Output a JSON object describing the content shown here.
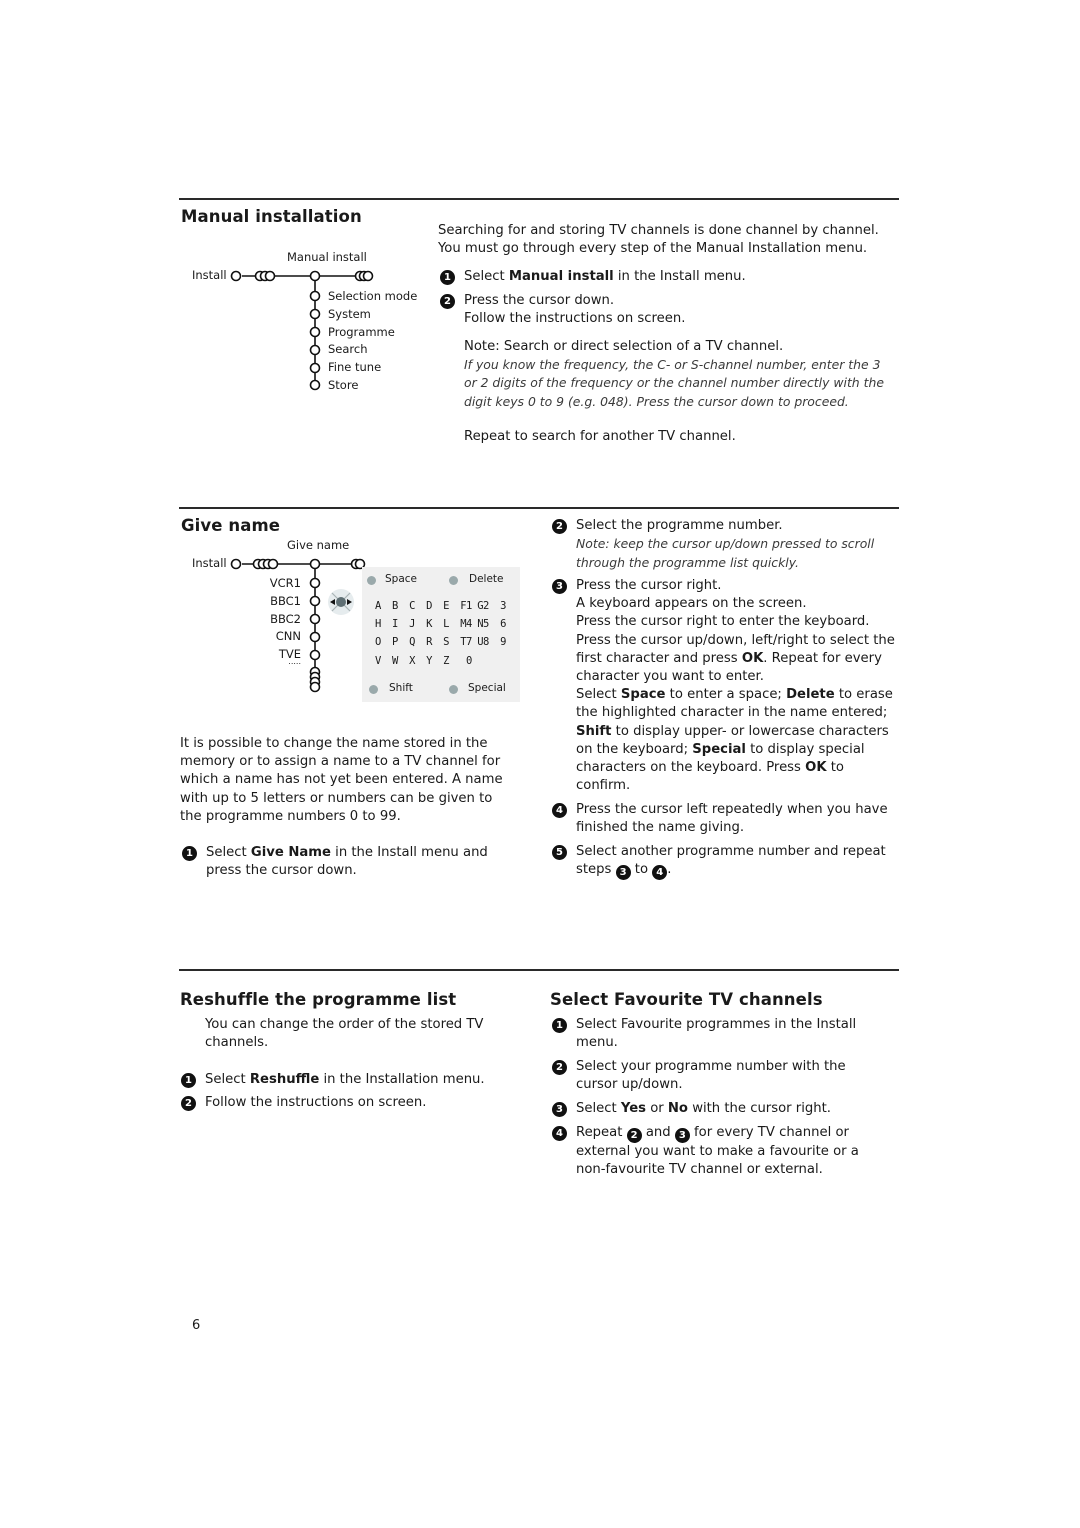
{
  "page_number": "6",
  "manual_installation": {
    "title": "Manual installation",
    "menu": {
      "header": "Manual install",
      "root": "Install",
      "items": [
        "Selection mode",
        "System",
        "Programme",
        "Search",
        "Fine tune",
        "Store"
      ]
    },
    "intro": "Searching for and storing TV channels is done channel by channel. You must go through every step of the Manual Installation menu.",
    "steps": [
      {
        "num": "1",
        "pre": "Select ",
        "bold": "Manual install",
        "post": " in the Install menu."
      },
      {
        "num": "2",
        "line1": "Press the cursor down.",
        "line2": "Follow the instructions on screen."
      }
    ],
    "note_title": "Note: Search or direct selection of a TV channel.",
    "note_body": "If you know the frequency, the C- or S-channel number, enter the 3 or 2 digits of the frequency or the channel number directly with the digit keys 0 to 9 (e.g. 048). Press the cursor down to proceed.",
    "repeat": "Repeat to search for another TV channel."
  },
  "give_name": {
    "title": "Give name",
    "menu": {
      "header": "Give name",
      "root": "Install",
      "channels": [
        "VCR1",
        "BBC1",
        "BBC2",
        "CNN",
        "TVE"
      ],
      "more": "....."
    },
    "keyboard": {
      "space": "Space",
      "delete": "Delete",
      "shift": "Shift",
      "special": "Special",
      "letters": [
        "ABCDEFG",
        "HIJKLMN",
        "OPQRSTU",
        "VWXYZ"
      ],
      "digits": [
        "123",
        "456",
        "789",
        "0"
      ],
      "button_color": "#9aa9ab"
    },
    "intro": "It is possible to change the name stored in the memory or to assign a name to a TV channel for which a name has not yet been entered. A name with up to 5 letters or numbers can be given to the programme numbers 0 to 99.",
    "step1": {
      "num": "1",
      "pre": "Select ",
      "bold": "Give Name",
      "post": " in the Install menu and press the cursor down."
    },
    "step2": {
      "num": "2",
      "text": "Select the programme number.",
      "note": "Note: keep the cursor up/down pressed to scroll through the programme list quickly."
    },
    "step3": {
      "num": "3",
      "lines": [
        "Press the cursor right.",
        "A keyboard appears on the screen.",
        "Press the cursor right to enter the keyboard."
      ],
      "select_text_a": "Press the cursor up/down, left/right to select the first character and press ",
      "ok1": "OK",
      "select_text_b": ". Repeat for every character you want to enter.",
      "s_pre": "Select ",
      "space": "Space",
      "s_mid1": " to enter a space; ",
      "delete": "Delete",
      "s_mid2": " to erase the highlighted character in the name entered; ",
      "shift": "Shift",
      "s_mid3": " to display upper- or lowercase characters on the keyboard; ",
      "special": "Special",
      "s_mid4": " to display special characters on the keyboard. Press ",
      "ok2": "OK",
      "s_end": " to confirm."
    },
    "step4": {
      "num": "4",
      "text": "Press the cursor left repeatedly when you have finished the name giving."
    },
    "step5": {
      "num": "5",
      "pre": "Select another programme number and repeat steps ",
      "a": "3",
      "mid": " to ",
      "b": "4",
      "post": "."
    }
  },
  "reshuffle": {
    "title": "Reshuffle the programme list",
    "intro": "You can change the order of the stored TV channels.",
    "step1": {
      "num": "1",
      "pre": "Select ",
      "bold": "Reshuffle",
      "post": " in the Installation menu."
    },
    "step2": {
      "num": "2",
      "text": "Follow the instructions on screen."
    }
  },
  "favourites": {
    "title": "Select Favourite TV channels",
    "step1": {
      "num": "1",
      "text": "Select Favourite programmes in the Install menu."
    },
    "step2": {
      "num": "2",
      "text": "Select your programme number with the cursor up/down."
    },
    "step3": {
      "num": "3",
      "pre": "Select ",
      "yes": "Yes",
      "or": " or ",
      "no": "No",
      "post": " with the cursor right."
    },
    "step4": {
      "num": "4",
      "pre": "Repeat ",
      "a": "2",
      "mid": " and ",
      "b": "3",
      "post": " for every TV channel or external you want to make a favourite or a non-favourite TV channel or external."
    }
  }
}
